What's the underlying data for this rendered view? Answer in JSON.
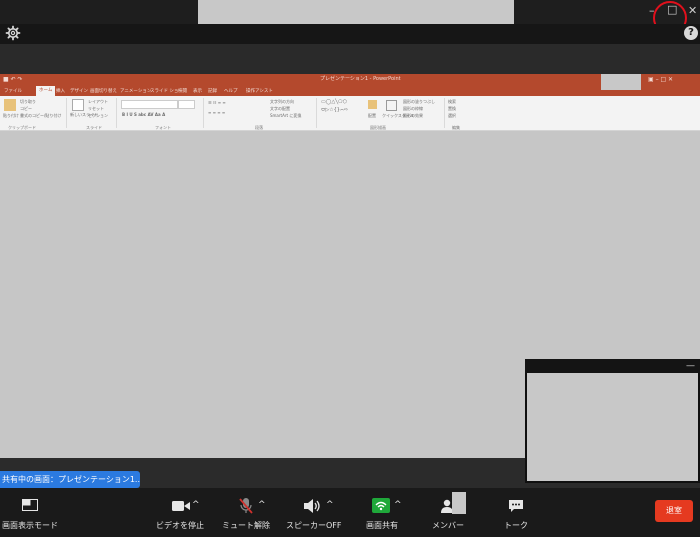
{
  "title_bar": {
    "minimize_glyph": "–",
    "maximize_glyph": "□",
    "close_glyph": "✕"
  },
  "toolbar": {
    "settings_icon": "gear-icon",
    "help_glyph": "?"
  },
  "shared_window": {
    "app_title": "プレゼンテーション1 - PowerPoint",
    "tabs": [
      "ファイル",
      "ホーム",
      "挿入",
      "デザイン",
      "画面切り替え",
      "アニメーション",
      "スライド ショー",
      "校閲",
      "表示",
      "記録",
      "ヘルプ",
      "操作アシスト"
    ],
    "active_tab": "ホーム",
    "ribbon_items": {
      "paste": "貼り付け",
      "cut": "切り取り",
      "copy": "コピー",
      "format_painter": "書式のコピー/貼り付け",
      "new_slide": "新しいスライド",
      "layout": "レイアウト",
      "reset": "リセット",
      "section": "セクション",
      "text_direction": "文字列の方向",
      "align_text": "文字の配置",
      "smartart": "SmartArt に変換",
      "arrange": "配置",
      "quick_styles": "クイックスタイル",
      "shape_fill": "図形の塗りつぶし",
      "shape_outline": "図形の枠線",
      "shape_effects": "図形の効果",
      "find": "検索",
      "replace": "置換",
      "select": "選択"
    },
    "groups": [
      "クリップボード",
      "スライド",
      "フォント",
      "段落",
      "図形描画",
      "編集"
    ],
    "colors": {
      "accent": "#b4492d",
      "canvas": "#c6c6c6"
    }
  },
  "share_banner": {
    "text": "共有中の画面：プレゼンテーション1..."
  },
  "floating_video": {
    "minimize_glyph": "—"
  },
  "controls": {
    "view_mode": "画面表示モード",
    "stop_video": "ビデオを停止",
    "unmute": "ミュート解除",
    "speaker_off": "スピーカーOFF",
    "share_screen": "画面共有",
    "members": "メンバー",
    "chat": "トーク",
    "leave": "退室",
    "caret": "^",
    "colors": {
      "leave": "#e53a20",
      "share": "#1fa83a",
      "muted": "#d0312d"
    }
  }
}
